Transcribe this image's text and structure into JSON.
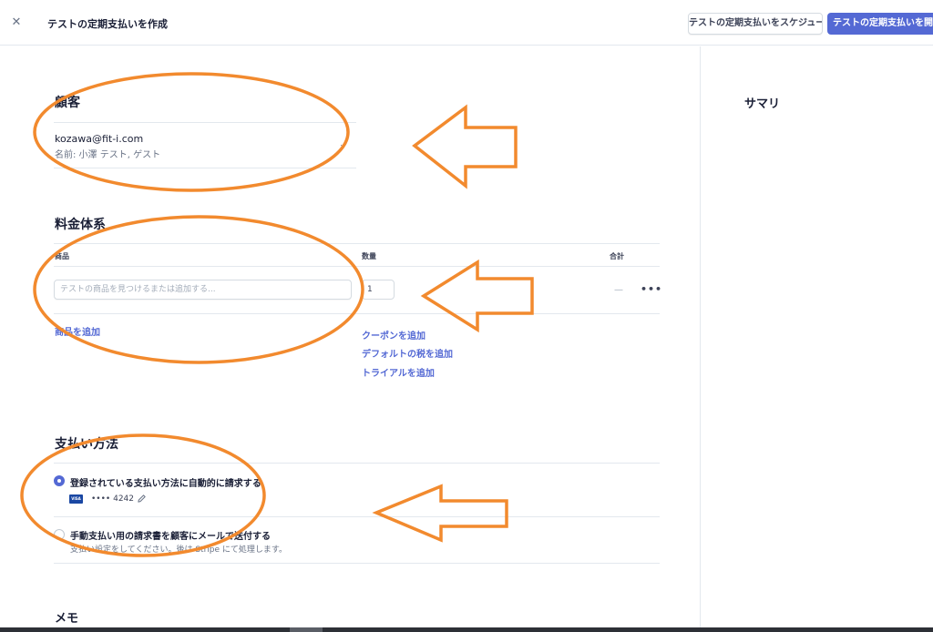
{
  "header": {
    "close_icon": "✕",
    "title": "テストの定期支払いを作成",
    "schedule_button": "テストの定期支払いをスケジュール",
    "start_button": "テストの定期支払いを開始"
  },
  "summary": {
    "title": "サマリ"
  },
  "customer": {
    "section_title": "顧客",
    "email": "kozawa@fit-i.com",
    "name_line": "名前: 小澤 テスト, ゲスト",
    "chevron": "⌄"
  },
  "pricing": {
    "section_title": "料金体系",
    "col_product": "商品",
    "col_quantity": "数量",
    "col_total": "合計",
    "product_placeholder": "テストの商品を見つけるまたは追加する...",
    "quantity_value": "1",
    "total_value": "—",
    "more_icon": "•••",
    "add_product_link": "商品を追加",
    "add_coupon_link": "クーポンを追加",
    "add_tax_link": "デフォルトの税を追加",
    "add_trial_link": "トライアルを追加"
  },
  "payment": {
    "section_title": "支払い方法",
    "option_auto_label": "登録されている支払い方法に自動的に請求する",
    "card_brand": "VISA",
    "card_number": "•••• 4242",
    "option_invoice_label": "手動支払い用の請求書を顧客にメールで送付する",
    "option_invoice_desc": "支払い設定をしてください。後は Stripe にて処理します。"
  },
  "memo": {
    "section_title": "メモ"
  },
  "colors": {
    "accent": "#5469d4",
    "annotation": "#f28a2e"
  }
}
